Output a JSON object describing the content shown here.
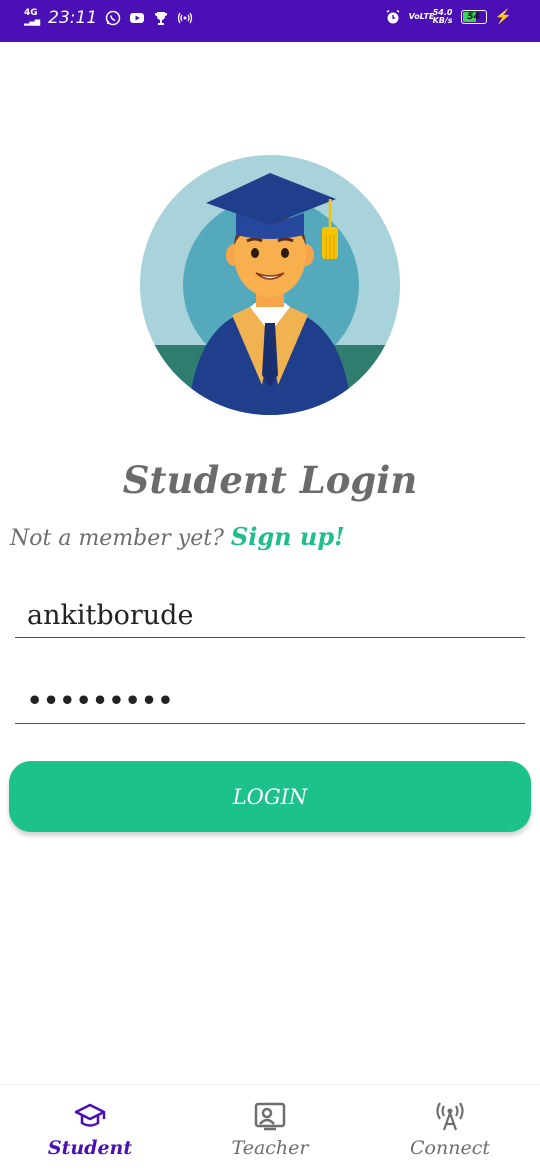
{
  "status_bar": {
    "network": "4G",
    "time": "23:11",
    "volte": "VoLTE",
    "speed": "54.0",
    "speed_unit": "KB/s",
    "battery": "54",
    "bg_color": "#4a0fb5"
  },
  "login": {
    "title": "Student Login",
    "signup_prompt": "Not a member yet?",
    "signup_link": "Sign up!",
    "username_value": "ankitborude",
    "password_value": "•••••••••",
    "login_button": "LOGIN",
    "accent_color": "#1dc18b"
  },
  "bottom_nav": {
    "items": [
      {
        "label": "Student",
        "icon": "graduation-cap-icon",
        "active": true
      },
      {
        "label": "Teacher",
        "icon": "id-badge-icon",
        "active": false
      },
      {
        "label": "Connect",
        "icon": "broadcast-antenna-icon",
        "active": false
      }
    ],
    "active_color": "#4a0fb5"
  }
}
